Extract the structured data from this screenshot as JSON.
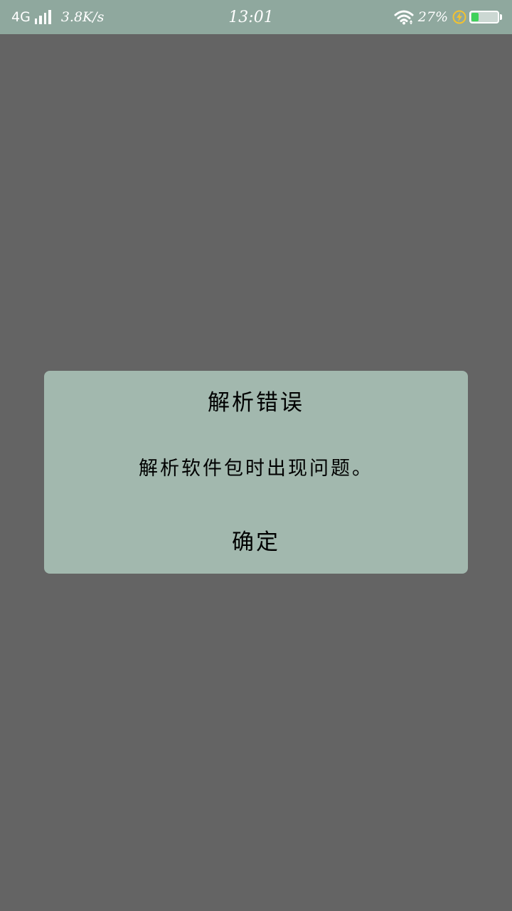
{
  "status_bar": {
    "network_type": "4G",
    "network_speed": "3.8K/s",
    "time": "13:01",
    "battery_percent": "27%",
    "battery_level": 0.27,
    "signal_icon": "signal-bars-icon",
    "wifi_icon": "wifi-icon",
    "charging_icon": "charging-bolt-icon",
    "battery_icon": "battery-icon",
    "colors": {
      "background": "#8fa89e",
      "battery_fill": "#3fd15a",
      "charging": "#f2c230"
    }
  },
  "dialog": {
    "title": "解析错误",
    "message": "解析软件包时出现问题。",
    "confirm_label": "确定",
    "colors": {
      "background": "#a2b8ae",
      "text": "#111111"
    }
  },
  "screen": {
    "colors": {
      "scrim": "#646464"
    }
  }
}
